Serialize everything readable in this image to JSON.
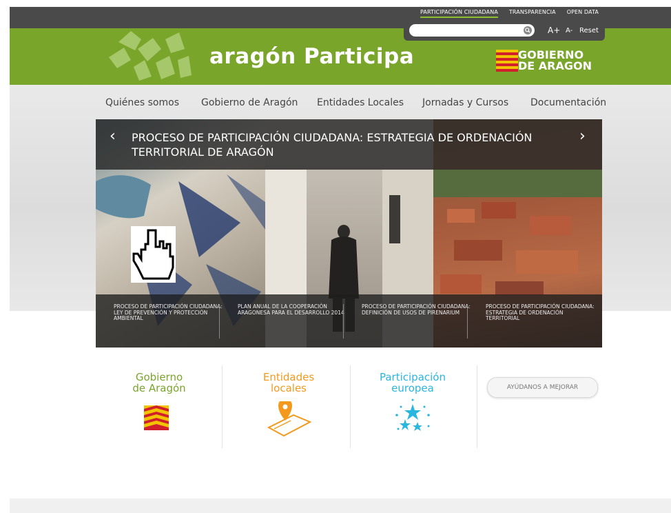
{
  "top_links": [
    "PARTICIPACIÓN CIUDADANA",
    "TRANSPARENCIA",
    "OPEN DATA"
  ],
  "search": {
    "placeholder": ""
  },
  "font_controls": {
    "increase": "A+",
    "decrease": "A-",
    "reset": "Reset"
  },
  "site": {
    "logo_text": "aragón Participa",
    "gov_line1": "GOBIERNO",
    "gov_line2": "DE ARAGON"
  },
  "nav": [
    "Quiénes somos",
    "Gobierno de Aragón",
    "Entidades Locales",
    "Jornadas y Cursos",
    "Documentación"
  ],
  "slider": {
    "title": "PROCESO DE PARTICIPACIÓN CIUDADANA: ESTRATEGIA DE ORDENACIÓN TERRITORIAL DE ARAGÓN",
    "prev": "‹",
    "next": "›",
    "items": [
      "PROCESO DE PARTICIPACIÓN CIUDADANA: LEY DE PREVENCIÓN Y PROTECCIÓN AMBIENTAL",
      "PLAN ANUAL DE LA COOPERACIÓN ARAGONESA PARA EL DESARROLLO 2014",
      "PROCESO DE PARTICIPACIÓN CIUDADANA: DEFINICIÓN DE USOS DE PIRENARIUM",
      "PROCESO DE PARTICIPACIÓN CIUDADANA: ESTRATEGIA DE ORDENACIÓN TERRITORIAL"
    ]
  },
  "cards": [
    {
      "line1": "Gobierno",
      "line2": "de Aragón",
      "color": "#7aa52b"
    },
    {
      "line1": "Entidades",
      "line2": "locales",
      "color": "#f39a1e"
    },
    {
      "line1": "Participación",
      "line2": "europea",
      "color": "#2bb6e0"
    }
  ],
  "help_button": "AYÚDANOS A MEJORAR",
  "colors": {
    "brand_green": "#7aa52b",
    "dark_bar": "#4a4a4a"
  }
}
